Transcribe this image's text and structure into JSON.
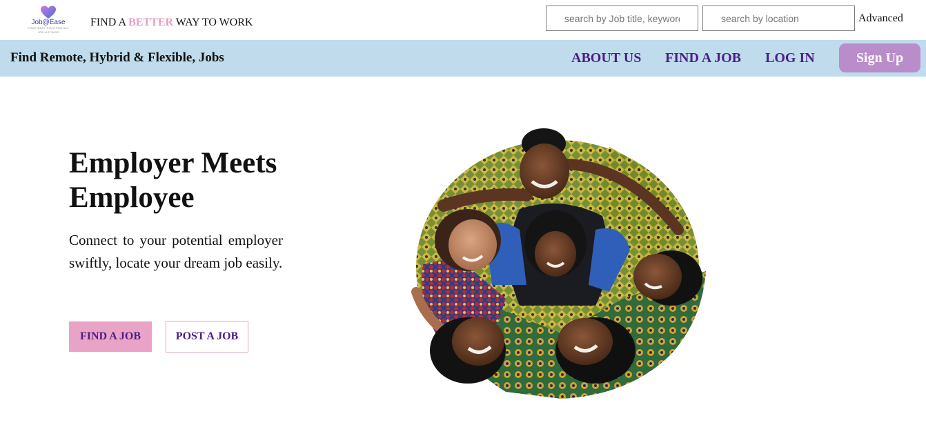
{
  "brand": {
    "logo_text": "Job@Ease",
    "logo_sub": "YOUR EASY PLUG FOR ALL JOB LISTINGS",
    "tagline_pre": "FIND A ",
    "tagline_highlight": "BETTER",
    "tagline_post": " WAY TO WORK"
  },
  "search": {
    "job_placeholder": "search by Job title, keywords",
    "location_placeholder": "search by location",
    "advanced_label": "Advanced"
  },
  "nav": {
    "title": "Find Remote, Hybrid & Flexible, Jobs",
    "about": "ABOUT US",
    "find_job": "FIND A JOB",
    "login": "LOG IN",
    "signup": "Sign Up"
  },
  "hero": {
    "title": "Employer Meets Employee",
    "description": "Connect to your potential employer swiftly, locate your dream job easily.",
    "find_button": "FIND A JOB",
    "post_button": "POST A JOB"
  },
  "colors": {
    "nav_bg": "#bfdbec",
    "accent_purple": "#4b1f86",
    "signup_bg": "#b98dc9",
    "pink": "#e8a3c6"
  }
}
